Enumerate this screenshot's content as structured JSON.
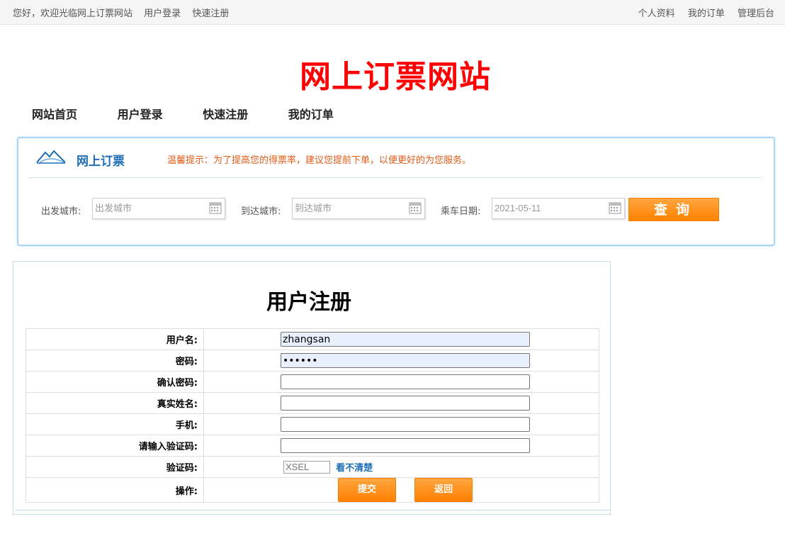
{
  "topbar": {
    "welcome": "您好，欢迎光临网上订票网站",
    "login": "用户登录",
    "register": "快速注册",
    "profile": "个人资料",
    "my_orders": "我的订单",
    "admin": "管理后台"
  },
  "site": {
    "title": "网上订票网站"
  },
  "nav": {
    "items": [
      {
        "label": "网站首页"
      },
      {
        "label": "用户登录"
      },
      {
        "label": "快速注册"
      },
      {
        "label": "我的订单"
      }
    ]
  },
  "search": {
    "title": "网上订票",
    "tip": "温馨提示：为了提高您的得票率，建议您提前下单，以便更好的为您服务。",
    "from_label": "出发城市:",
    "from_placeholder": "出发城市",
    "to_label": "到达城市:",
    "to_placeholder": "到达城市",
    "date_label": "乘车日期:",
    "date_value": "2021-05-11",
    "query_button": "查询"
  },
  "register": {
    "title": "用户注册",
    "username_label": "用户名:",
    "username_value": "zhangsan",
    "password_label": "密码:",
    "password_value": "••••••",
    "confirm_label": "确认密码:",
    "realname_label": "真实姓名:",
    "phone_label": "手机:",
    "enter_captcha_label": "请输入验证码:",
    "captcha_label": "验证码:",
    "captcha_text": "XSEL",
    "refresh_link": "看不清楚",
    "action_label": "操作:",
    "submit_button": "提交",
    "back_button": "返回"
  },
  "colors": {
    "site_title": "#ff0000",
    "accent_blue": "#1e6db5",
    "tip_orange": "#e25b18",
    "button_orange": "#ff8200"
  }
}
